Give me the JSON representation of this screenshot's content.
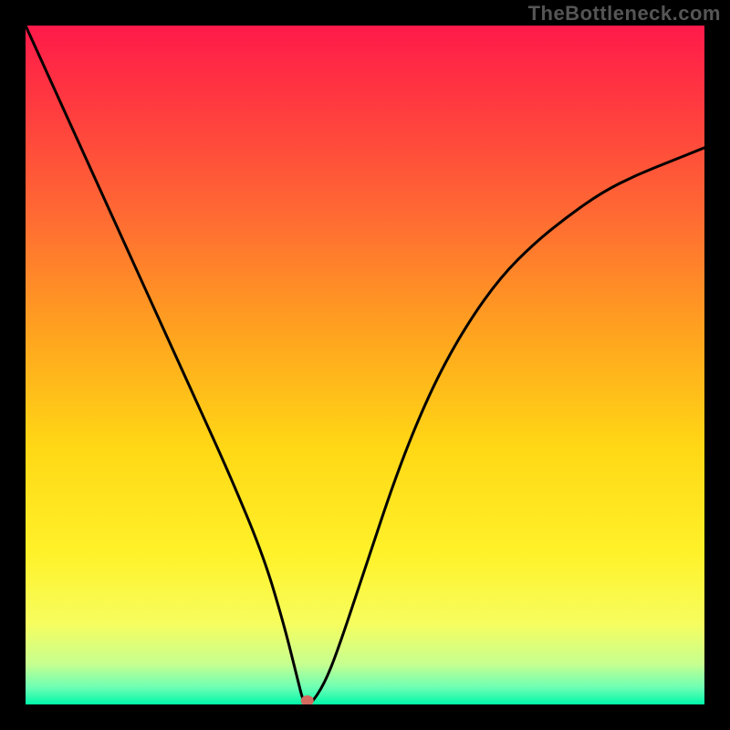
{
  "watermark": "TheBottleneck.com",
  "chart_data": {
    "type": "line",
    "title": "",
    "xlabel": "",
    "ylabel": "",
    "xlim": [
      0,
      100
    ],
    "ylim": [
      0,
      100
    ],
    "series": [
      {
        "name": "curve",
        "x": [
          0,
          5,
          10,
          15,
          20,
          25,
          30,
          35,
          38,
          40,
          41,
          42,
          44,
          46,
          50,
          55,
          60,
          65,
          70,
          75,
          80,
          85,
          90,
          95,
          100
        ],
        "y": [
          100,
          89,
          78,
          67,
          56,
          45,
          34,
          22,
          12,
          4,
          0,
          0,
          3,
          8,
          20,
          35,
          47,
          56,
          63,
          68,
          72,
          75.5,
          78,
          80,
          82
        ]
      }
    ],
    "marker": {
      "x": 41.5,
      "y": 0
    },
    "gradient_stops": [
      {
        "pos": 0.0,
        "color": "#ff1a4a"
      },
      {
        "pos": 0.12,
        "color": "#ff3b3f"
      },
      {
        "pos": 0.28,
        "color": "#ff6a33"
      },
      {
        "pos": 0.45,
        "color": "#ffa21f"
      },
      {
        "pos": 0.62,
        "color": "#ffd715"
      },
      {
        "pos": 0.78,
        "color": "#fff22a"
      },
      {
        "pos": 0.88,
        "color": "#f7fd5e"
      },
      {
        "pos": 0.94,
        "color": "#c7ff8f"
      },
      {
        "pos": 0.975,
        "color": "#6dffb4"
      },
      {
        "pos": 1.0,
        "color": "#00f7a8"
      }
    ]
  }
}
